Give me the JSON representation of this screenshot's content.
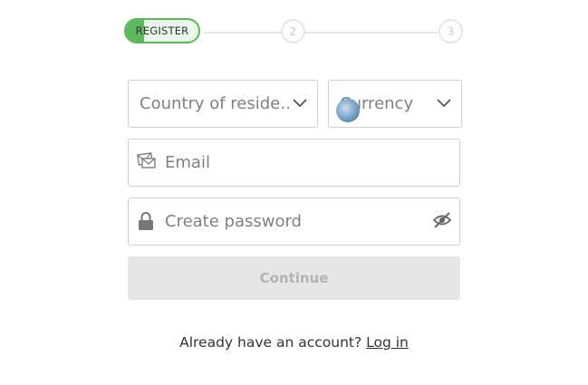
{
  "stepper": {
    "step1_label": "REGISTER",
    "step2_label": "2",
    "step3_label": "3",
    "active_color": "#5cb85c"
  },
  "form": {
    "country_placeholder": "Country of reside…",
    "currency_placeholder": "Currency",
    "email_placeholder": "Email",
    "password_placeholder": "Create password",
    "continue_label": "Continue"
  },
  "footer": {
    "prompt": "Already have an account?",
    "login_link": "Log in"
  },
  "icons": {
    "email": "mail-icon",
    "password": "lock-icon",
    "visibility": "eye-slash-icon",
    "dropdown": "chevron-down-icon",
    "currency": "globe-icon"
  }
}
